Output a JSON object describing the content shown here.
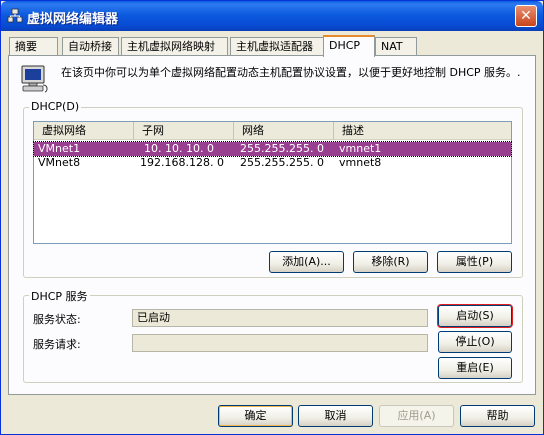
{
  "window": {
    "title": "虚拟网络编辑器",
    "close_glyph": "✕"
  },
  "tabs": [
    {
      "label": "摘要"
    },
    {
      "label": "自动桥接"
    },
    {
      "label": "主机虚拟网络映射"
    },
    {
      "label": "主机虚拟适配器"
    },
    {
      "label": "DHCP",
      "active": true
    },
    {
      "label": "NAT"
    }
  ],
  "info": {
    "text": "在该页中你可以为单个虚拟网络配置动态主机配置协议设置，以便于更好地控制 DHCP 服务。."
  },
  "dhcp_group": {
    "label": "DHCP(D)",
    "columns": [
      "虚拟网络",
      "子网",
      "网络",
      "描述"
    ],
    "rows": [
      {
        "network": "VMnet1",
        "subnet": "10. 10. 10. 0",
        "mask": "255.255.255. 0",
        "desc": "vmnet1",
        "selected": true
      },
      {
        "network": "VMnet8",
        "subnet": "192.168.128. 0",
        "mask": "255.255.255. 0",
        "desc": "vmnet8",
        "selected": false
      }
    ],
    "buttons": {
      "add": "添加(A)...",
      "remove": "移除(R)",
      "properties": "属性(P)"
    }
  },
  "service_group": {
    "label": "DHCP 服务",
    "status_label": "服务状态:",
    "status_value": "已启动",
    "request_label": "服务请求:",
    "request_value": "",
    "buttons": {
      "start": "启动(S)",
      "stop": "停止(O)",
      "restart": "重启(E)"
    }
  },
  "footer": {
    "ok": "确定",
    "cancel": "取消",
    "apply": "应用(A)",
    "help": "帮助"
  },
  "colors": {
    "selection": "#993f8f",
    "titlebar": "#0a5ddf",
    "highlight_frame": "#e02020"
  }
}
